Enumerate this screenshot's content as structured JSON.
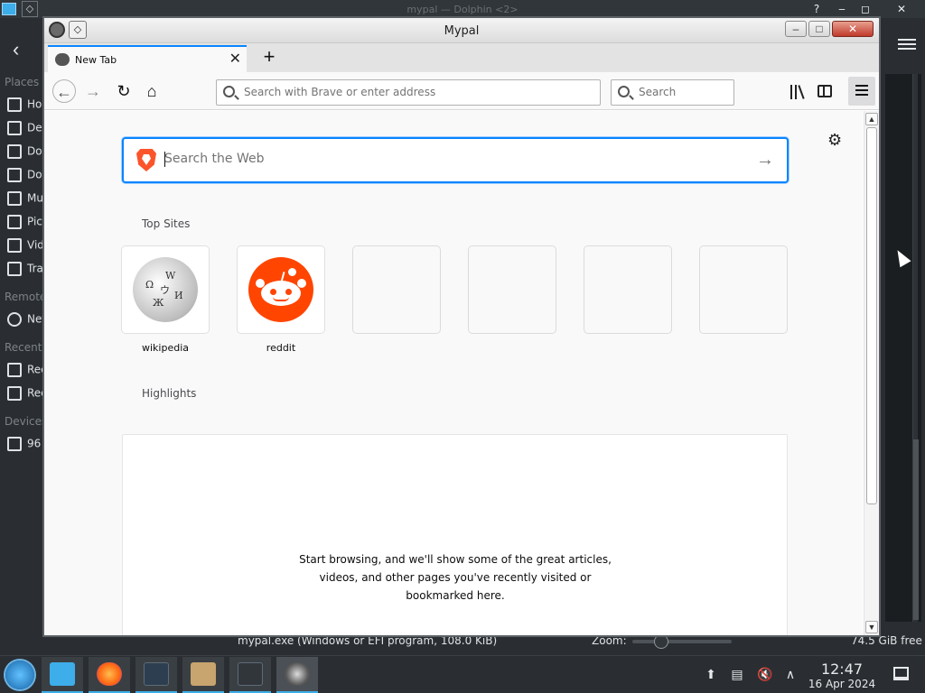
{
  "dolphin": {
    "title": "mypal — Dolphin <2>",
    "places_heading": "Places",
    "places": [
      "Home",
      "Desktop",
      "Documents",
      "Downloads",
      "Music",
      "Pictures",
      "Videos",
      "Trash"
    ],
    "remote_heading": "Remote",
    "remote": [
      "Network"
    ],
    "recent_heading": "Recent",
    "recent": [
      "Recent Files",
      "Recent Locations"
    ],
    "devices_heading": "Devices",
    "devices": [
      "96"
    ],
    "status_file": "mypal.exe (Windows or EFI program, 108.0 KiB)",
    "zoom_label": "Zoom:",
    "free_space": "74.5 GiB free",
    "help_btn": "?",
    "minimize_btn": "‒",
    "maximize_btn": "◻",
    "close_btn": "✕"
  },
  "mypal": {
    "title": "Mypal",
    "win_minimize": "‒",
    "win_maximize": "□",
    "win_close": "✕",
    "tab": {
      "label": "New Tab",
      "close": "✕"
    },
    "new_tab_btn": "+",
    "nav": {
      "back": "←",
      "forward": "→",
      "reload": "↻",
      "home": "⌂"
    },
    "urlbar": {
      "placeholder": "Search with Brave or enter address",
      "value": ""
    },
    "searchbar": {
      "placeholder": "Search",
      "value": ""
    },
    "settings_icon": "⚙",
    "web_search": {
      "placeholder": "Search the Web",
      "value": "",
      "go": "→"
    },
    "top_sites_heading": "Top Sites",
    "top_sites": [
      {
        "label": "wikipedia",
        "icon": "wikipedia-globe-icon"
      },
      {
        "label": "reddit",
        "icon": "reddit-logo-icon"
      }
    ],
    "wiki_glyphs": [
      "Ω",
      "W",
      "И",
      "Ж",
      "ウ"
    ],
    "highlights_heading": "Highlights",
    "highlights_message": "Start browsing, and we'll show some of the great articles, videos, and other pages you've recently visited or bookmarked here.",
    "scroll_up": "▲",
    "scroll_down": "▼"
  },
  "taskbar": {
    "time": "12:47",
    "date": "16 Apr 2024",
    "tasks": [
      "dolphin-file-manager",
      "firefox",
      "system-settings",
      "archive-manager",
      "konsole",
      "mypal"
    ],
    "tray": [
      "updates-icon",
      "clipboard-icon",
      "volume-muted-icon",
      "tray-expand-icon"
    ],
    "tray_glyphs": [
      "⬆",
      "▤",
      "🔇",
      "∧"
    ]
  }
}
